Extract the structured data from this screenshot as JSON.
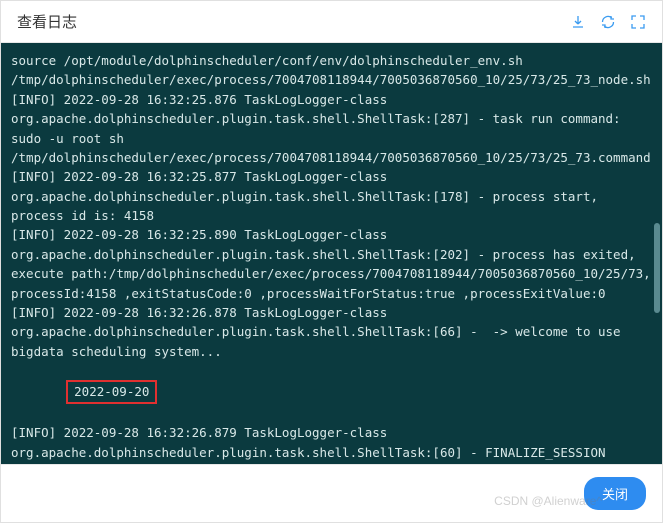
{
  "header": {
    "title": "查看日志",
    "icons": {
      "download": "download-icon",
      "refresh": "refresh-icon",
      "fullscreen": "fullscreen-icon"
    }
  },
  "log": {
    "lines": [
      "source /opt/module/dolphinscheduler/conf/env/dolphinscheduler_env.sh",
      "/tmp/dolphinscheduler/exec/process/7004708118944/7005036870560_10/25/73/25_73_node.sh",
      "[INFO] 2022-09-28 16:32:25.876 TaskLogLogger-class org.apache.dolphinscheduler.plugin.task.shell.ShellTask:[287] - task run command: sudo -u root sh /tmp/dolphinscheduler/exec/process/7004708118944/7005036870560_10/25/73/25_73.command",
      "[INFO] 2022-09-28 16:32:25.877 TaskLogLogger-class org.apache.dolphinscheduler.plugin.task.shell.ShellTask:[178] - process start, process id is: 4158",
      "[INFO] 2022-09-28 16:32:25.890 TaskLogLogger-class org.apache.dolphinscheduler.plugin.task.shell.ShellTask:[202] - process has exited, execute path:/tmp/dolphinscheduler/exec/process/7004708118944/7005036870560_10/25/73, processId:4158 ,exitStatusCode:0 ,processWaitForStatus:true ,processExitValue:0",
      "[INFO] 2022-09-28 16:32:26.878 TaskLogLogger-class org.apache.dolphinscheduler.plugin.task.shell.ShellTask:[66] -  -> welcome to use bigdata scheduling system..."
    ],
    "highlighted": "2022-09-20",
    "lines_after": [
      "[INFO] 2022-09-28 16:32:26.879 TaskLogLogger-class org.apache.dolphinscheduler.plugin.task.shell.ShellTask:[60] - FINALIZE_SESSION"
    ]
  },
  "footer": {
    "close_label": "关闭",
    "watermark": "CSDN @Alienware^"
  }
}
